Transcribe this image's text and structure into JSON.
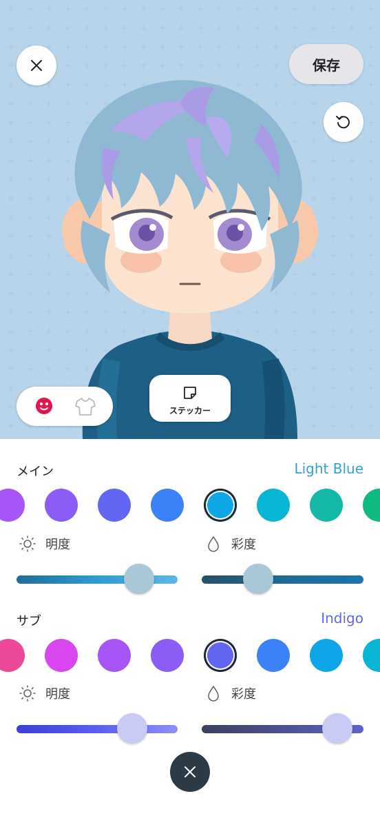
{
  "header": {
    "save_label": "保存",
    "close_icon": "close-icon",
    "reset_icon": "reset-rotate-icon"
  },
  "mode_switch": {
    "items": [
      {
        "name": "face",
        "icon": "smiley-face-icon",
        "active": true,
        "color": "#e0174d"
      },
      {
        "name": "clothes",
        "icon": "tshirt-icon",
        "active": false,
        "color": "#b9bcc2"
      }
    ]
  },
  "sticker": {
    "label": "ステッカー",
    "icon": "sticker-note-icon"
  },
  "main_color": {
    "title": "メイン",
    "selected_name": "Light Blue",
    "selected_name_color": "#2fa3d9",
    "swatches": [
      "#a855f7",
      "#8b5cf6",
      "#6366f1",
      "#3b82f6",
      "#0ea5e9",
      "#06b6d4",
      "#14b8a6",
      "#10b981"
    ],
    "selected_index": 4,
    "brightness": {
      "label": "明度",
      "icon": "sun-icon",
      "value": 0.76
    },
    "saturation": {
      "label": "彩度",
      "icon": "drop-icon",
      "value": 0.35
    }
  },
  "sub_color": {
    "title": "サブ",
    "selected_name": "Indigo",
    "selected_name_color": "#6366f1",
    "swatches": [
      "#ec4899",
      "#d946ef",
      "#a855f7",
      "#8b5cf6",
      "#6366f1",
      "#3b82f6",
      "#0ea5e9",
      "#06b6d4"
    ],
    "selected_index": 4,
    "brightness": {
      "label": "明度",
      "icon": "sun-icon",
      "value": 0.72
    },
    "saturation": {
      "label": "彩度",
      "icon": "drop-icon",
      "value": 0.84
    }
  },
  "bottom": {
    "close_icon": "close-icon"
  }
}
